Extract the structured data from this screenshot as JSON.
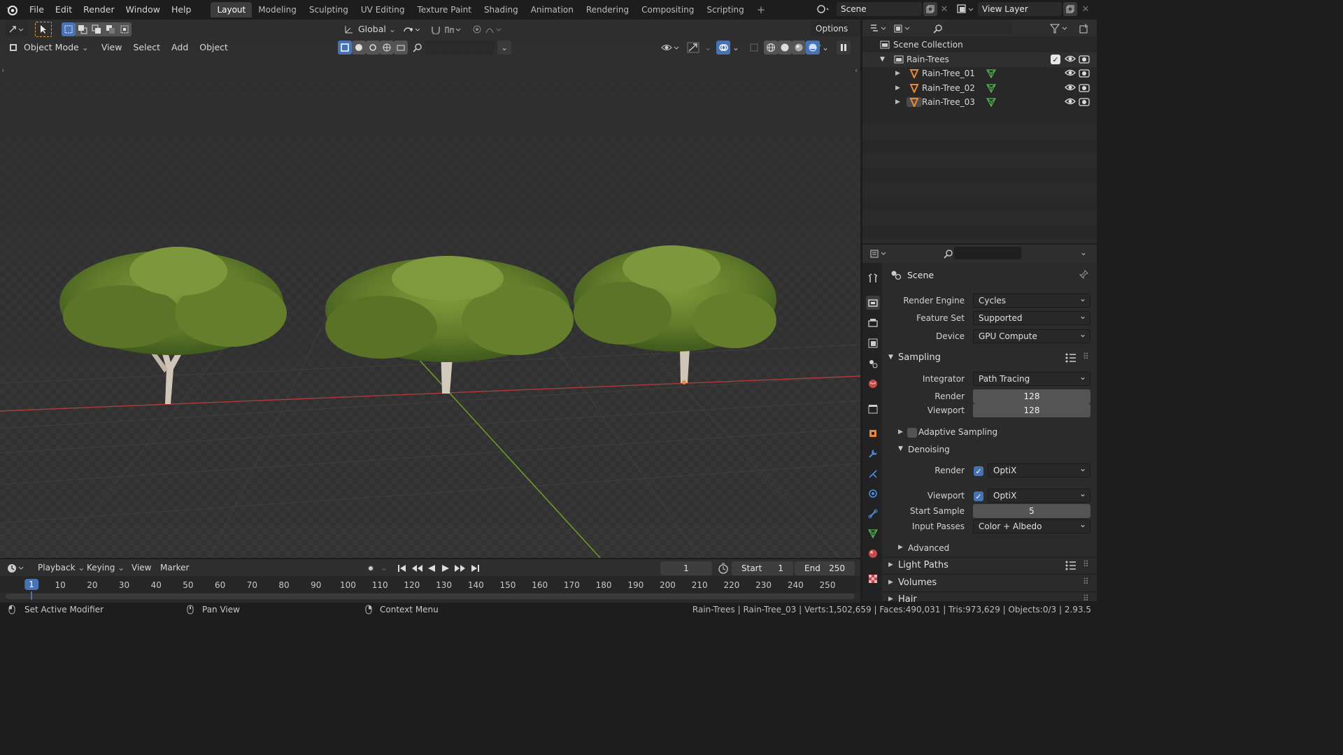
{
  "menu": [
    "File",
    "Edit",
    "Render",
    "Window",
    "Help"
  ],
  "workspaces": [
    "Layout",
    "Modeling",
    "Sculpting",
    "UV Editing",
    "Texture Paint",
    "Shading",
    "Animation",
    "Rendering",
    "Compositing",
    "Scripting"
  ],
  "active_workspace": "Layout",
  "scene_name": "Scene",
  "view_layer": "View Layer",
  "viewport": {
    "mode": "Object Mode",
    "menus": [
      "View",
      "Select",
      "Add",
      "Object"
    ],
    "transform_orientation": "Global",
    "options_label": "Options"
  },
  "outliner": {
    "root": "Scene Collection",
    "collection": "Rain-Trees",
    "objects": [
      "Rain-Tree_01",
      "Rain-Tree_02",
      "Rain-Tree_03"
    ]
  },
  "properties": {
    "context": "Scene",
    "render_engine_label": "Render Engine",
    "render_engine": "Cycles",
    "feature_set_label": "Feature Set",
    "feature_set": "Supported",
    "device_label": "Device",
    "device": "GPU Compute",
    "sampling": {
      "title": "Sampling",
      "integrator_label": "Integrator",
      "integrator": "Path Tracing",
      "render_label": "Render",
      "render": "128",
      "viewport_label": "Viewport",
      "viewport": "128",
      "adaptive": "Adaptive Sampling",
      "denoising": "Denoising",
      "den_render_label": "Render",
      "den_render": "OptiX",
      "den_viewport_label": "Viewport",
      "den_viewport": "OptiX",
      "start_sample_label": "Start Sample",
      "start_sample": "5",
      "input_passes_label": "Input Passes",
      "input_passes": "Color + Albedo",
      "advanced": "Advanced"
    },
    "panels": [
      "Light Paths",
      "Volumes",
      "Hair"
    ]
  },
  "timeline": {
    "menus": [
      "Playback",
      "Keying",
      "View",
      "Marker"
    ],
    "current_frame": "1",
    "start_label": "Start",
    "start": "1",
    "end_label": "End",
    "end": "250",
    "ticks": [
      "1",
      "10",
      "20",
      "30",
      "40",
      "50",
      "60",
      "70",
      "80",
      "90",
      "100",
      "110",
      "120",
      "130",
      "140",
      "150",
      "160",
      "170",
      "180",
      "190",
      "200",
      "210",
      "220",
      "230",
      "240",
      "250"
    ]
  },
  "statusbar": {
    "hint1": "Set Active Modifier",
    "hint2": "Pan View",
    "hint3": "Context Menu",
    "stats": "Rain-Trees | Rain-Tree_03 | Verts:1,502,659 | Faces:490,031 | Tris:973,629 | Objects:0/3 | 2.93.5"
  },
  "colors": {
    "accent_blue": "#4772b3",
    "x_axis": "#b03a3a",
    "y_axis": "#6a9a2a",
    "object_orange": "#e8883a",
    "mesh_green": "#4fb44f"
  }
}
